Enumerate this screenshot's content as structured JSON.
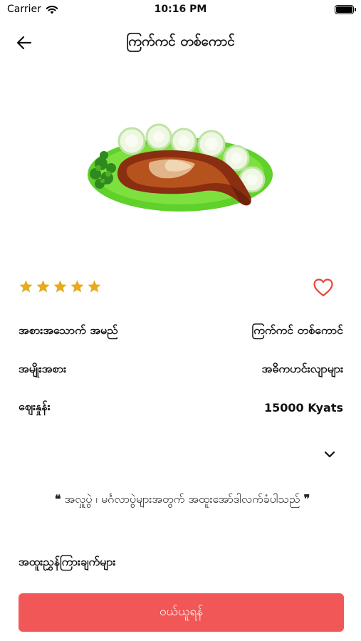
{
  "status_bar": {
    "carrier": "Carrier",
    "time": "10:16 PM"
  },
  "nav": {
    "title": "ကြက်ကင် တစ်ကောင်"
  },
  "rating": {
    "stars": 5,
    "max": 5,
    "color": "#e6ac1e"
  },
  "favorite": {
    "color": "#e8453c"
  },
  "details": [
    {
      "label": "အစားအသောက် အမည်",
      "value": "ကြက်ကင် တစ်ကောင်"
    },
    {
      "label": "အမျိုးအစား",
      "value": "အဓိကဟင်းလျာများ"
    },
    {
      "label": "ဈေးနှုန်း",
      "value": "15000 Kyats"
    }
  ],
  "description": {
    "open_quote": "❝",
    "text": "အလှူပွဲ ၊ မင်္ဂလာပွဲများအတွက် အထူးအော်ဒါလက်ခံပါသည်",
    "close_quote": "❞"
  },
  "features_label": "အထူးညွှန်ကြားချက်များ",
  "order_button": {
    "label": "ဝယ်ယူရန်",
    "color": "#f25757"
  }
}
